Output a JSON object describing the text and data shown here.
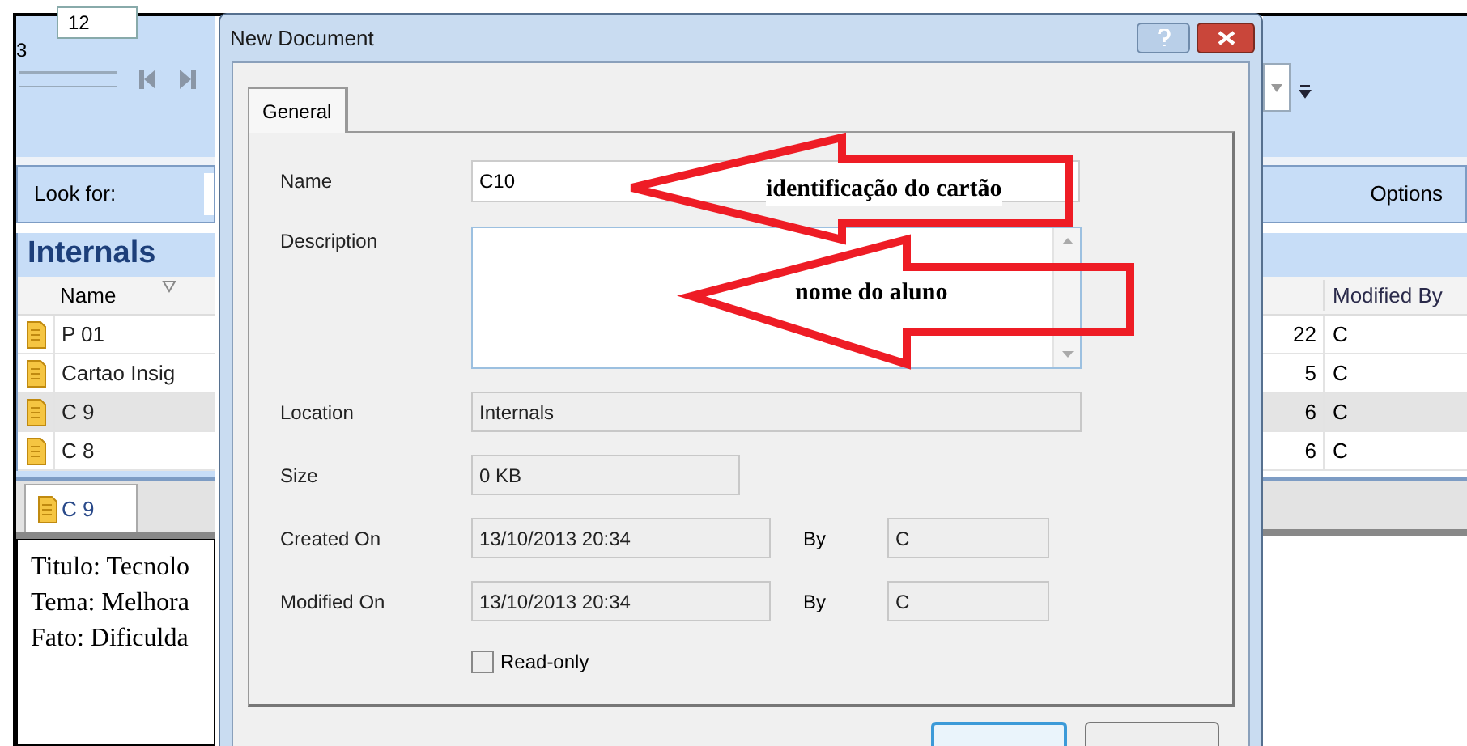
{
  "app": {
    "font_size": "12",
    "toolbar_digit": "3",
    "search_label": "Look for:",
    "options_label": "Options",
    "folder_title": "Internals",
    "columns": [
      {
        "label": "Name"
      },
      {
        "label": "Modified By"
      }
    ],
    "rows": [
      {
        "name": "P 01",
        "column_2": "22",
        "modified_by": "C",
        "selected": false
      },
      {
        "name": "Cartao Insig",
        "column_2": "5",
        "modified_by": "C",
        "selected": false
      },
      {
        "name": "C 9",
        "column_2": "6",
        "modified_by": "C",
        "selected": true
      },
      {
        "name": "C 8",
        "column_2": "6",
        "modified_by": "C",
        "selected": false
      }
    ],
    "doc_tab": {
      "label": "C 9",
      "selected": true
    },
    "doc_lines": [
      "Titulo: Tecnolo",
      "Tema: Melhora",
      "Fato: Dificulda"
    ]
  },
  "dialog": {
    "title": "New Document",
    "tabs": [
      {
        "label": "General",
        "selected": true
      }
    ],
    "name": {
      "label": "Name",
      "value": "C10"
    },
    "description": {
      "label": "Description"
    },
    "location": {
      "label": "Location",
      "value": "Internals"
    },
    "size": {
      "label": "Size",
      "value": "0 KB"
    },
    "created": {
      "label": "Created On",
      "value": "13/10/2013 20:34",
      "by_label": "By",
      "by_value": "C"
    },
    "modified": {
      "label": "Modified On",
      "value": "13/10/2013 20:34",
      "by_label": "By",
      "by_value": "C"
    },
    "read_only": {
      "label": "Read-only",
      "checked": false
    }
  },
  "annotations": [
    {
      "text": "identificação do cartão"
    },
    {
      "text": "nome do aluno"
    }
  ]
}
